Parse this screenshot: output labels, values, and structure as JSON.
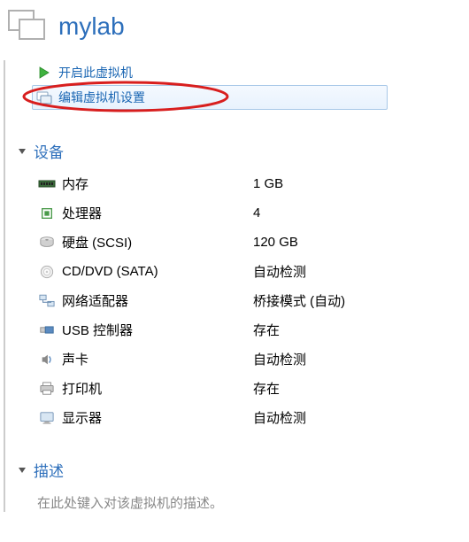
{
  "header": {
    "title": "mylab"
  },
  "actions": {
    "power_on": "开启此虚拟机",
    "edit_settings": "编辑虚拟机设置"
  },
  "sections": {
    "devices_label": "设备",
    "description_label": "描述"
  },
  "devices": {
    "memory": {
      "name": "内存",
      "value": "1 GB"
    },
    "cpu": {
      "name": "处理器",
      "value": "4"
    },
    "disk": {
      "name": "硬盘 (SCSI)",
      "value": "120 GB"
    },
    "cddvd": {
      "name": "CD/DVD (SATA)",
      "value": "自动检测"
    },
    "network": {
      "name": "网络适配器",
      "value": "桥接模式 (自动)"
    },
    "usb": {
      "name": "USB 控制器",
      "value": "存在"
    },
    "sound": {
      "name": "声卡",
      "value": "自动检测"
    },
    "printer": {
      "name": "打印机",
      "value": "存在"
    },
    "display": {
      "name": "显示器",
      "value": "自动检测"
    }
  },
  "description_placeholder": "在此处键入对该虚拟机的描述。"
}
